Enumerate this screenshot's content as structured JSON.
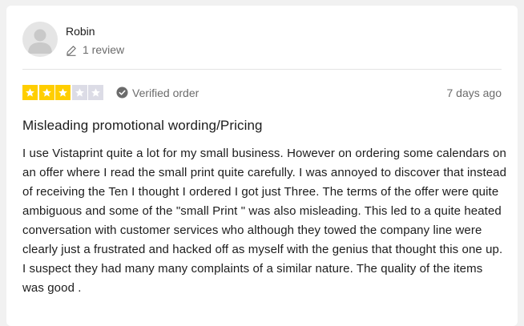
{
  "reviewer": {
    "name": "Robin",
    "review_count": "1 review",
    "avatar_icon": "user-silhouette-icon"
  },
  "rating": {
    "stars_filled": 3,
    "stars_total": 5,
    "filled_color": "#ffce00",
    "empty_color": "#dcdce6"
  },
  "verification": {
    "label": "Verified order",
    "icon": "check-circle-icon"
  },
  "date": "7 days ago",
  "review": {
    "title": "Misleading promotional wording/Pricing",
    "body": "I use Vistaprint quite a lot for my small business. However on ordering some calendars on an offer where I read the small print quite carefully. I was annoyed to discover that instead of receiving the Ten I thought I ordered I got just Three. The terms of the offer were quite ambiguous and some of the \"small Print \" was also misleading. This led to a quite heated conversation with customer services who although they towed the company line were clearly just a frustrated and hacked off as myself with the genius that thought this one up. I suspect they had many many complaints of a similar nature. The quality of the items was good ."
  }
}
